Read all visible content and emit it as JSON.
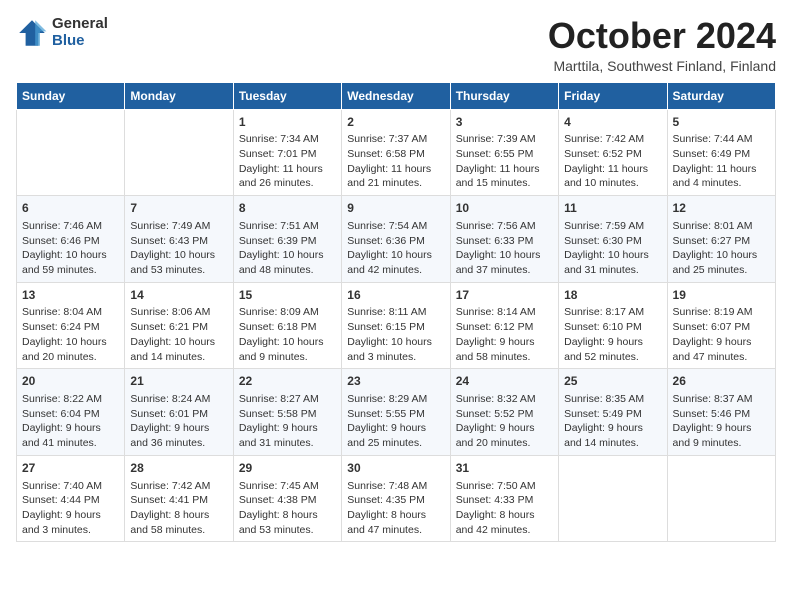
{
  "logo": {
    "general": "General",
    "blue": "Blue"
  },
  "title": "October 2024",
  "location": "Marttila, Southwest Finland, Finland",
  "headers": [
    "Sunday",
    "Monday",
    "Tuesday",
    "Wednesday",
    "Thursday",
    "Friday",
    "Saturday"
  ],
  "weeks": [
    [
      {
        "day": "",
        "info": ""
      },
      {
        "day": "",
        "info": ""
      },
      {
        "day": "1",
        "info": "Sunrise: 7:34 AM\nSunset: 7:01 PM\nDaylight: 11 hours\nand 26 minutes."
      },
      {
        "day": "2",
        "info": "Sunrise: 7:37 AM\nSunset: 6:58 PM\nDaylight: 11 hours\nand 21 minutes."
      },
      {
        "day": "3",
        "info": "Sunrise: 7:39 AM\nSunset: 6:55 PM\nDaylight: 11 hours\nand 15 minutes."
      },
      {
        "day": "4",
        "info": "Sunrise: 7:42 AM\nSunset: 6:52 PM\nDaylight: 11 hours\nand 10 minutes."
      },
      {
        "day": "5",
        "info": "Sunrise: 7:44 AM\nSunset: 6:49 PM\nDaylight: 11 hours\nand 4 minutes."
      }
    ],
    [
      {
        "day": "6",
        "info": "Sunrise: 7:46 AM\nSunset: 6:46 PM\nDaylight: 10 hours\nand 59 minutes."
      },
      {
        "day": "7",
        "info": "Sunrise: 7:49 AM\nSunset: 6:43 PM\nDaylight: 10 hours\nand 53 minutes."
      },
      {
        "day": "8",
        "info": "Sunrise: 7:51 AM\nSunset: 6:39 PM\nDaylight: 10 hours\nand 48 minutes."
      },
      {
        "day": "9",
        "info": "Sunrise: 7:54 AM\nSunset: 6:36 PM\nDaylight: 10 hours\nand 42 minutes."
      },
      {
        "day": "10",
        "info": "Sunrise: 7:56 AM\nSunset: 6:33 PM\nDaylight: 10 hours\nand 37 minutes."
      },
      {
        "day": "11",
        "info": "Sunrise: 7:59 AM\nSunset: 6:30 PM\nDaylight: 10 hours\nand 31 minutes."
      },
      {
        "day": "12",
        "info": "Sunrise: 8:01 AM\nSunset: 6:27 PM\nDaylight: 10 hours\nand 25 minutes."
      }
    ],
    [
      {
        "day": "13",
        "info": "Sunrise: 8:04 AM\nSunset: 6:24 PM\nDaylight: 10 hours\nand 20 minutes."
      },
      {
        "day": "14",
        "info": "Sunrise: 8:06 AM\nSunset: 6:21 PM\nDaylight: 10 hours\nand 14 minutes."
      },
      {
        "day": "15",
        "info": "Sunrise: 8:09 AM\nSunset: 6:18 PM\nDaylight: 10 hours\nand 9 minutes."
      },
      {
        "day": "16",
        "info": "Sunrise: 8:11 AM\nSunset: 6:15 PM\nDaylight: 10 hours\nand 3 minutes."
      },
      {
        "day": "17",
        "info": "Sunrise: 8:14 AM\nSunset: 6:12 PM\nDaylight: 9 hours\nand 58 minutes."
      },
      {
        "day": "18",
        "info": "Sunrise: 8:17 AM\nSunset: 6:10 PM\nDaylight: 9 hours\nand 52 minutes."
      },
      {
        "day": "19",
        "info": "Sunrise: 8:19 AM\nSunset: 6:07 PM\nDaylight: 9 hours\nand 47 minutes."
      }
    ],
    [
      {
        "day": "20",
        "info": "Sunrise: 8:22 AM\nSunset: 6:04 PM\nDaylight: 9 hours\nand 41 minutes."
      },
      {
        "day": "21",
        "info": "Sunrise: 8:24 AM\nSunset: 6:01 PM\nDaylight: 9 hours\nand 36 minutes."
      },
      {
        "day": "22",
        "info": "Sunrise: 8:27 AM\nSunset: 5:58 PM\nDaylight: 9 hours\nand 31 minutes."
      },
      {
        "day": "23",
        "info": "Sunrise: 8:29 AM\nSunset: 5:55 PM\nDaylight: 9 hours\nand 25 minutes."
      },
      {
        "day": "24",
        "info": "Sunrise: 8:32 AM\nSunset: 5:52 PM\nDaylight: 9 hours\nand 20 minutes."
      },
      {
        "day": "25",
        "info": "Sunrise: 8:35 AM\nSunset: 5:49 PM\nDaylight: 9 hours\nand 14 minutes."
      },
      {
        "day": "26",
        "info": "Sunrise: 8:37 AM\nSunset: 5:46 PM\nDaylight: 9 hours\nand 9 minutes."
      }
    ],
    [
      {
        "day": "27",
        "info": "Sunrise: 7:40 AM\nSunset: 4:44 PM\nDaylight: 9 hours\nand 3 minutes."
      },
      {
        "day": "28",
        "info": "Sunrise: 7:42 AM\nSunset: 4:41 PM\nDaylight: 8 hours\nand 58 minutes."
      },
      {
        "day": "29",
        "info": "Sunrise: 7:45 AM\nSunset: 4:38 PM\nDaylight: 8 hours\nand 53 minutes."
      },
      {
        "day": "30",
        "info": "Sunrise: 7:48 AM\nSunset: 4:35 PM\nDaylight: 8 hours\nand 47 minutes."
      },
      {
        "day": "31",
        "info": "Sunrise: 7:50 AM\nSunset: 4:33 PM\nDaylight: 8 hours\nand 42 minutes."
      },
      {
        "day": "",
        "info": ""
      },
      {
        "day": "",
        "info": ""
      }
    ]
  ]
}
